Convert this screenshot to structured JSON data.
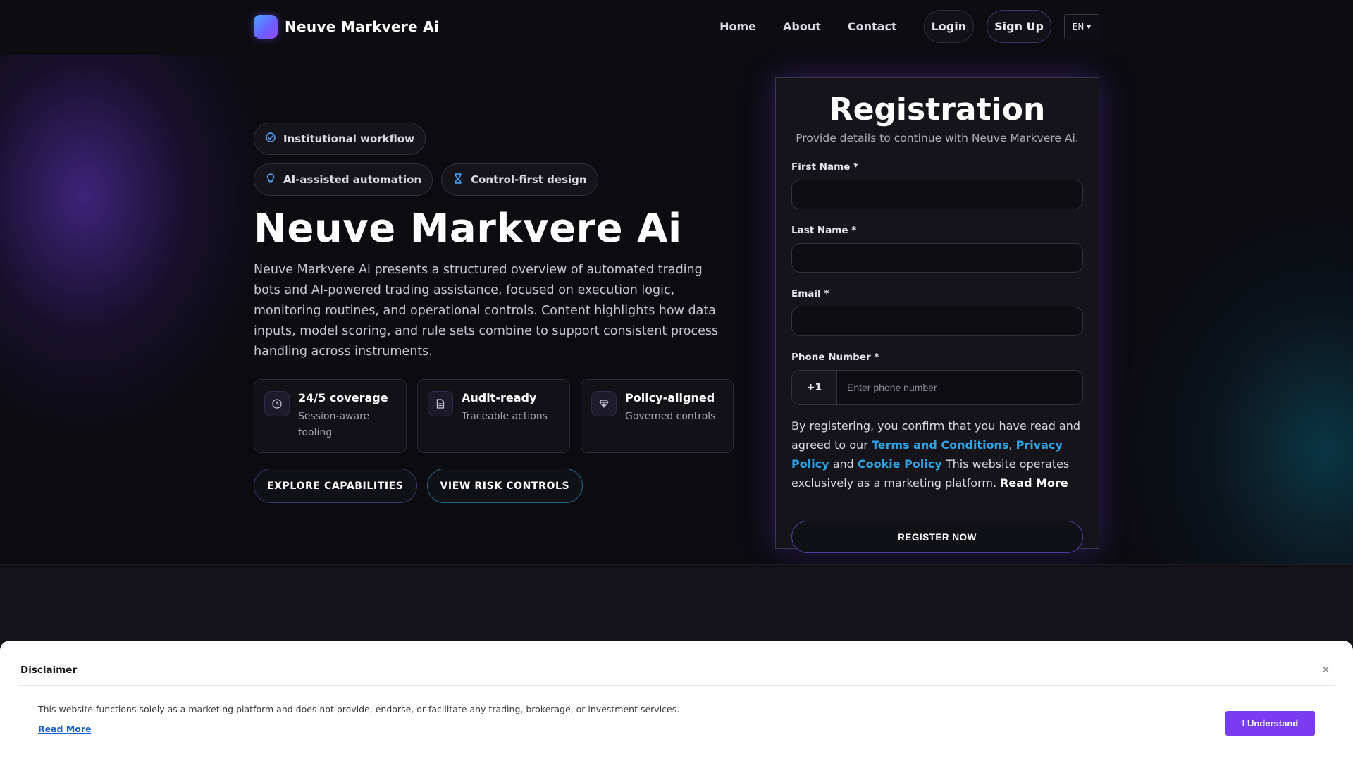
{
  "header": {
    "brand": "Neuve Markvere Ai",
    "nav": [
      "Home",
      "About",
      "Contact"
    ],
    "login": "Login",
    "signup": "Sign Up",
    "language": "EN ▾"
  },
  "hero": {
    "chips": [
      {
        "icon": "check-circle-icon",
        "label": "Institutional workflow"
      },
      {
        "icon": "lightbulb-icon",
        "label": "AI-assisted automation"
      },
      {
        "icon": "hourglass-icon",
        "label": "Control-first design"
      }
    ],
    "title": "Neuve Markvere Ai",
    "description": "Neuve Markvere Ai presents a structured overview of automated trading bots and AI-powered trading assistance, focused on execution logic, monitoring routines, and operational controls. Content highlights how data inputs, model scoring, and rule sets combine to support consistent process handling across instruments.",
    "features": [
      {
        "icon": "clock-icon",
        "title": "24/5 coverage",
        "subtitle": "Session-aware tooling"
      },
      {
        "icon": "document-icon",
        "title": "Audit-ready",
        "subtitle": "Traceable actions"
      },
      {
        "icon": "diamond-icon",
        "title": "Policy-aligned",
        "subtitle": "Governed controls"
      }
    ],
    "cta_primary": "EXPLORE CAPABILITIES",
    "cta_secondary": "VIEW RISK CONTROLS"
  },
  "registration": {
    "title": "Registration",
    "subtitle": "Provide details to continue with Neuve Markvere Ai.",
    "first_name_label": "First Name *",
    "last_name_label": "Last Name *",
    "email_label": "Email *",
    "phone_label": "Phone Number *",
    "phone_code": "+1",
    "phone_placeholder": "Enter phone number",
    "consent_prefix": "By registering, you confirm that you have read and agreed to our ",
    "terms": "Terms and Conditions",
    "comma": ", ",
    "privacy": "Privacy Policy",
    "and": " and ",
    "cookie": "Cookie Policy",
    "consent_suffix": " This website operates exclusively as a marketing platform. ",
    "read_more": "Read More",
    "submit": "REGISTER NOW"
  },
  "disclaimer": {
    "title": "Disclaimer",
    "close": "×",
    "text": "This website functions solely as a marketing platform and does not provide, endorse, or facilitate any trading, brokerage, or investment services.",
    "read_more": "Read More",
    "accept": "I Understand"
  }
}
